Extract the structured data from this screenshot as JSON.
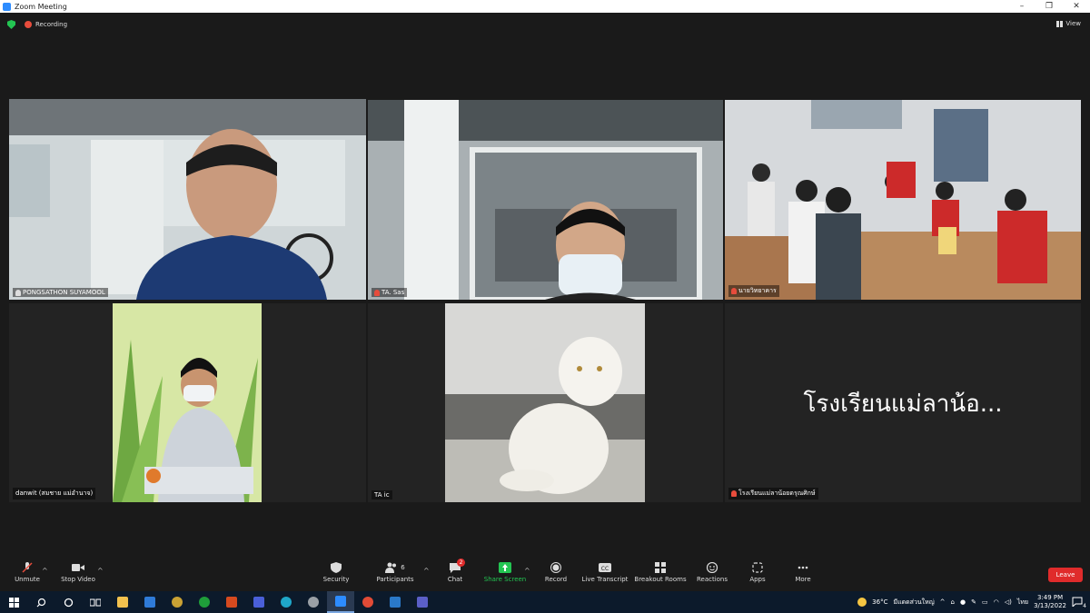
{
  "window": {
    "title": "Zoom Meeting"
  },
  "status": {
    "recording_label": "Recording",
    "view_label": "View"
  },
  "tiles": [
    {
      "name": "PONGSATHON SUYAMOOL",
      "muted": false
    },
    {
      "name": "TA. Sas",
      "muted": true
    },
    {
      "name": "นายวิทยาคาร",
      "muted": true
    },
    {
      "name": "danwit (สมชาย แม่อำนาจ)",
      "muted": false
    },
    {
      "name": "TA ic",
      "muted": false
    },
    {
      "name": "โรงเรียนแม่ลาน้อยดรุณศิกษ์",
      "muted": true,
      "display_name": "โรงเรียนแม่ลาน้อ..."
    }
  ],
  "toolbar": {
    "unmute": "Unmute",
    "stop_video": "Stop Video",
    "security": "Security",
    "participants": "Participants",
    "participants_count": "6",
    "chat": "Chat",
    "chat_badge": "2",
    "share_screen": "Share Screen",
    "record": "Record",
    "live_transcript": "Live Transcript",
    "breakout_rooms": "Breakout Rooms",
    "reactions": "Reactions",
    "apps": "Apps",
    "more": "More",
    "leave": "Leave"
  },
  "taskbar": {
    "weather": "36°C",
    "weather_desc": "มีแดดส่วนใหญ่",
    "language": "ไทย",
    "time": "3:49 PM",
    "date": "3/13/2022",
    "notification_count": "4"
  },
  "colors": {
    "active_speaker": "#c8e06c",
    "share_green": "#23c552",
    "leave_red": "#e02b2b"
  }
}
